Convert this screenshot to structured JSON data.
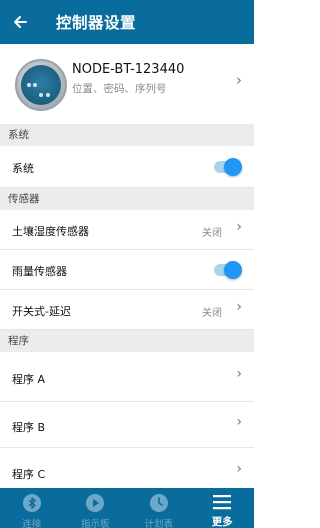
{
  "header": {
    "title": "控制器设置",
    "back_icon": "arrow-left-icon"
  },
  "device": {
    "name": "NODE-BT-123440",
    "subtitle": "位置、密码、序列号",
    "image_icon": "controller-device-icon"
  },
  "sections": {
    "system": "系统",
    "sensors": "传感器",
    "programs": "程序"
  },
  "rows": {
    "system": {
      "label": "系统",
      "toggle_on": true
    },
    "soil_sensor": {
      "label": "土壤湿度传感器",
      "value": "关闭"
    },
    "rain_sensor": {
      "label": "雨量传感器",
      "toggle_on": true
    },
    "switch_delay": {
      "label": "开关式-延迟",
      "value": "关闭"
    },
    "program_a": {
      "label": "程序 A"
    },
    "program_b": {
      "label": "程序 B"
    },
    "program_c": {
      "label": "程序 C"
    }
  },
  "tabs": [
    {
      "label": "连接",
      "icon": "bluetooth-icon",
      "active": false
    },
    {
      "label": "指示板",
      "icon": "play-icon",
      "active": false
    },
    {
      "label": "计划表",
      "icon": "clock-icon",
      "active": false
    },
    {
      "label": "更多",
      "icon": "menu-icon",
      "active": true
    }
  ],
  "colors": {
    "primary": "#0a6c9c",
    "toggle_on": "#2196f3",
    "toggle_track": "#a9d4ee",
    "tab_inactive": "#6fa8c7"
  }
}
